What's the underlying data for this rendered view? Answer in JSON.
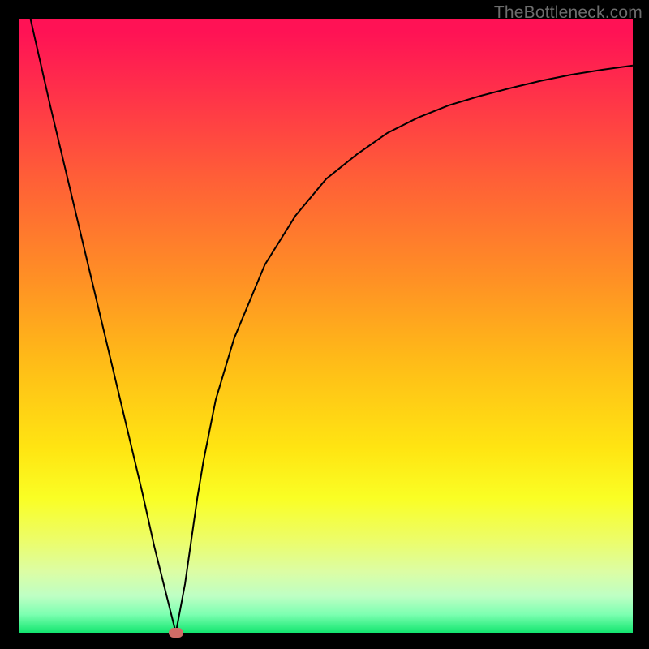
{
  "chart_data": {
    "type": "line",
    "title": "",
    "xlabel": "",
    "ylabel": "",
    "xlim": [
      0,
      100
    ],
    "ylim": [
      0,
      100
    ],
    "grid": false,
    "watermark": "TheBottleneck.com",
    "series": [
      {
        "name": "bottleneck-curve",
        "x": [
          0,
          5,
          10,
          15,
          20,
          22,
          24,
          25.5,
          27,
          28,
          29,
          30,
          32,
          35,
          40,
          45,
          50,
          55,
          60,
          65,
          70,
          75,
          80,
          85,
          90,
          95,
          100
        ],
        "values": [
          108,
          86,
          65,
          44,
          23,
          14,
          6,
          0,
          8,
          15,
          22,
          28,
          38,
          48,
          60,
          68,
          74,
          78,
          81.5,
          84,
          86,
          87.5,
          88.8,
          90,
          91,
          91.8,
          92.5
        ]
      }
    ],
    "markers": [
      {
        "name": "optimal-point",
        "x": 25.5,
        "y": 0,
        "color": "#d06c67"
      }
    ],
    "colors": {
      "curve": "#000000",
      "marker": "#d06c67",
      "background_top": "#ff1255",
      "background_bottom": "#13e46f",
      "frame": "#000000"
    }
  }
}
